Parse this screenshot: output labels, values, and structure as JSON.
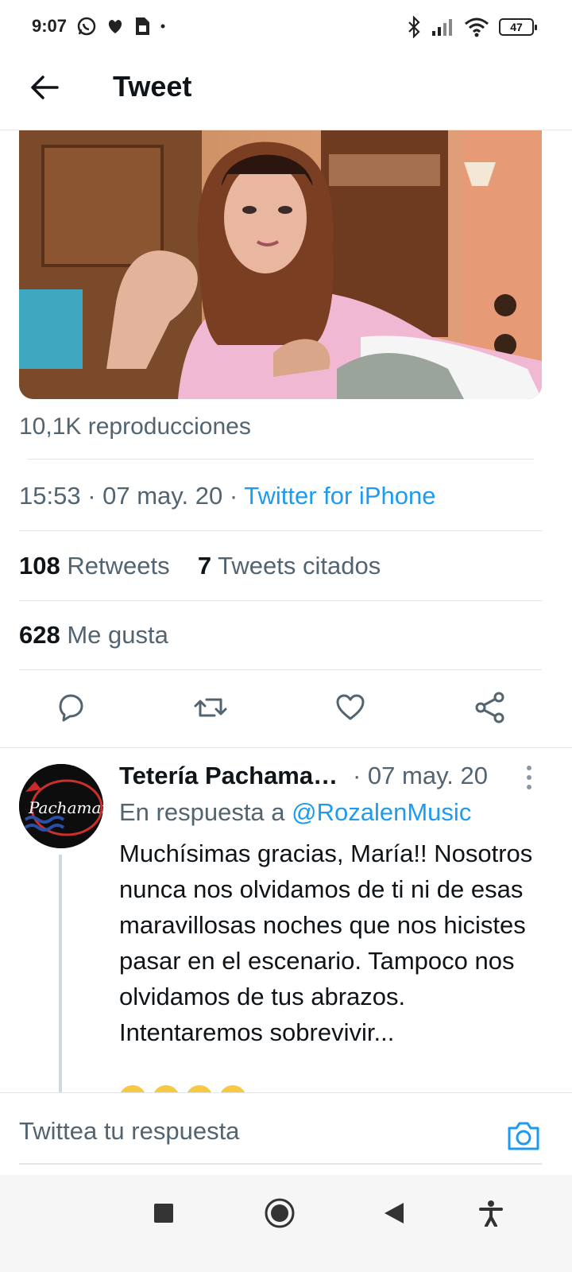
{
  "status_bar": {
    "time": "9:07",
    "battery": "47",
    "icons": [
      "whatsapp-icon",
      "app-icon",
      "sim-icon",
      "bluetooth-icon",
      "signal-icon",
      "wifi-icon",
      "battery-icon"
    ]
  },
  "header": {
    "title": "Tweet",
    "back_icon": "arrow-left-icon"
  },
  "tweet": {
    "views": "10,1K reproducciones",
    "time": "15:53",
    "date": "07 may. 20",
    "source": "Twitter for iPhone",
    "retweets_count": "108",
    "retweets_label": "Retweets",
    "quotes_count": "7",
    "quotes_label": "Tweets citados",
    "likes_count": "628",
    "likes_label": "Me gusta",
    "actions": [
      "reply-icon",
      "retweet-icon",
      "like-icon",
      "share-icon"
    ]
  },
  "reply": {
    "name": "Tetería Pachamama",
    "date": "· 07 may. 20",
    "reply_to_label": "En respuesta a",
    "reply_to_handle": "@RozalenMusic",
    "text": "Muchísimas gracias, María!! Nosotros nunca nos olvidamos de ti ni de esas maravillosas noches que nos hicistes pasar en el escenario. Tampoco nos olvidamos de tus abrazos. Intentaremos sobrevivir...",
    "avatar_text": "Pachamama"
  },
  "compose": {
    "placeholder": "Twittea tu respuesta"
  },
  "colors": {
    "accent": "#1d9bf0",
    "secondary_text": "#536471",
    "primary_text": "#0f1419",
    "divider": "#e1e6ea"
  }
}
